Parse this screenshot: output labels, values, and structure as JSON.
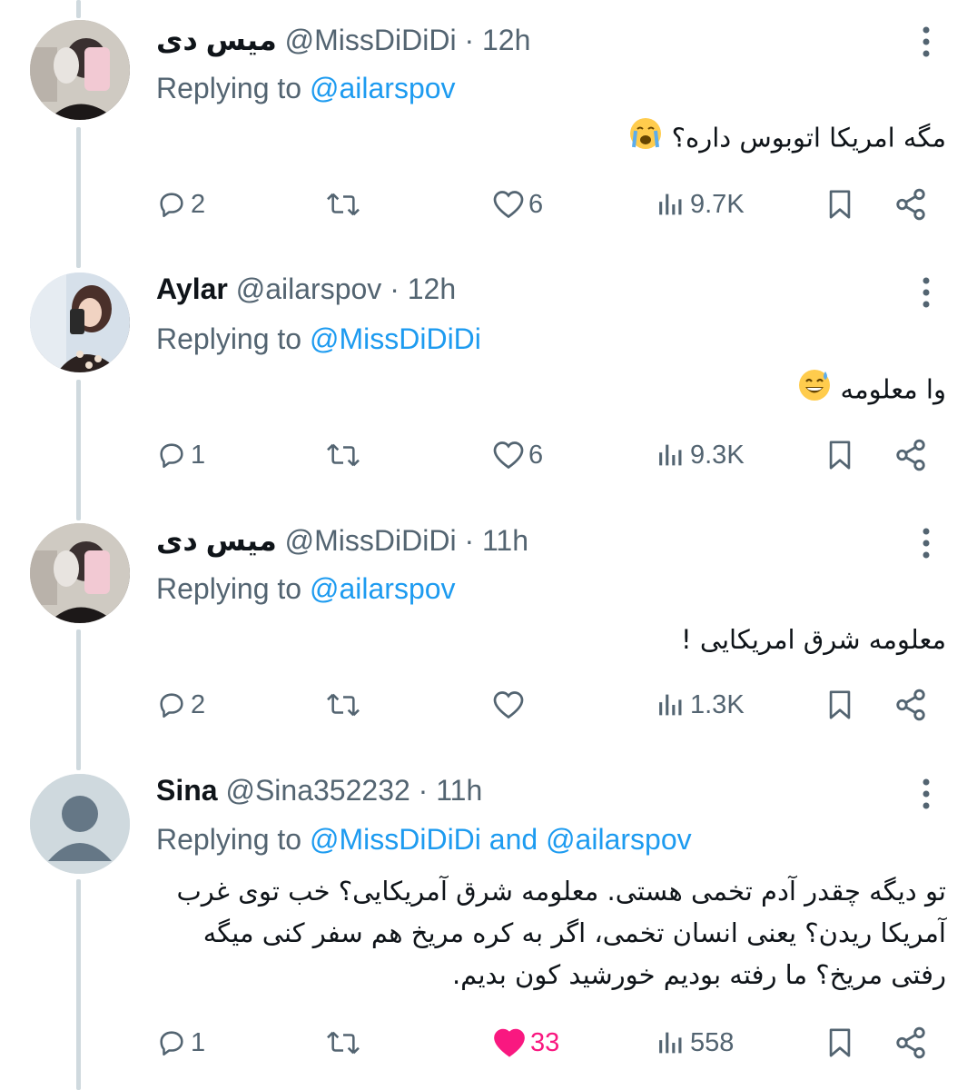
{
  "tweets": [
    {
      "name": "میس دی",
      "handle": "@MissDiDiDi",
      "time": "12h",
      "replying_label": "Replying to",
      "replying_to": "@ailarspov",
      "and_label": "",
      "replying_to_2": "",
      "text": "مگه امریکا اتوبوس داره؟",
      "emoji": "loudly-crying-face",
      "replies": "2",
      "retweets": "",
      "likes": "6",
      "liked": false,
      "views": "9.7K",
      "avatar": "missdi"
    },
    {
      "name": "Aylar",
      "handle": "@ailarspov",
      "time": "12h",
      "replying_label": "Replying to",
      "replying_to": "@MissDiDiDi",
      "and_label": "",
      "replying_to_2": "",
      "text": "وا معلومه",
      "emoji": "grinning-sweat-face",
      "replies": "1",
      "retweets": "",
      "likes": "6",
      "liked": false,
      "views": "9.3K",
      "avatar": "aylar"
    },
    {
      "name": "میس دی",
      "handle": "@MissDiDiDi",
      "time": "11h",
      "replying_label": "Replying to",
      "replying_to": "@ailarspov",
      "and_label": "",
      "replying_to_2": "",
      "text": "معلومه شرق امریکایی !",
      "emoji": "",
      "replies": "2",
      "retweets": "",
      "likes": "",
      "liked": false,
      "views": "1.3K",
      "avatar": "missdi"
    },
    {
      "name": "Sina",
      "handle": "@Sina352232",
      "time": "11h",
      "replying_label": "Replying to",
      "replying_to": "@MissDiDiDi",
      "and_label": "and",
      "replying_to_2": "@ailarspov",
      "text_lines": [
        "تو دیگه چقدر آدم تخمی هستی. معلومه شرق آمریکایی؟ خب توی غرب",
        "آمریکا ریدن؟ یعنی انسان تخمی، اگر به کره مریخ هم سفر کنی میگه",
        "رفتی مریخ؟ ما رفته بودیم خورشید کون بدیم."
      ],
      "replies": "1",
      "retweets": "",
      "likes": "33",
      "liked": true,
      "views": "558",
      "avatar": "default"
    }
  ],
  "colors": {
    "accent": "#1d9bf0",
    "muted": "#536471",
    "like": "#f91880",
    "thread_line": "#cfd9de"
  },
  "icons": {
    "reply": "reply-icon",
    "retweet": "retweet-icon",
    "like": "heart-icon",
    "views": "views-icon",
    "bookmark": "bookmark-icon",
    "share": "share-icon",
    "more": "more-icon"
  }
}
